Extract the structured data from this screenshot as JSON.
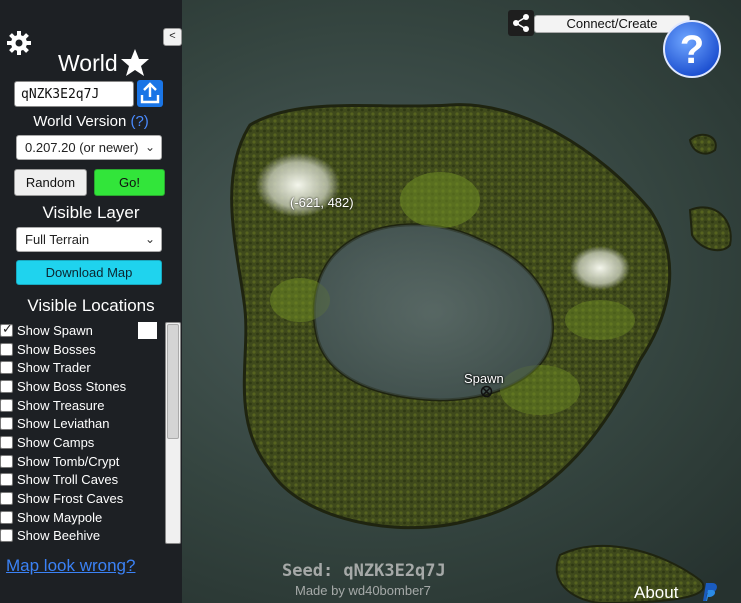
{
  "sidebar": {
    "world_title": "World",
    "seed_value": "qNZK3E2q7J",
    "world_version_label": "World Version",
    "world_version_help": "(?)",
    "world_version_selected": "0.207.20 (or newer)",
    "random_label": "Random",
    "go_label": "Go!",
    "visible_layer_label": "Visible Layer",
    "layer_selected": "Full Terrain",
    "download_label": "Download Map",
    "visible_locations_label": "Visible Locations",
    "locations": [
      {
        "label": "Show Spawn",
        "checked": true
      },
      {
        "label": "Show Bosses",
        "checked": false
      },
      {
        "label": "Show Trader",
        "checked": false
      },
      {
        "label": "Show Boss Stones",
        "checked": false
      },
      {
        "label": "Show Treasure",
        "checked": false
      },
      {
        "label": "Show Leviathan",
        "checked": false
      },
      {
        "label": "Show Camps",
        "checked": false
      },
      {
        "label": "Show Tomb/Crypt",
        "checked": false
      },
      {
        "label": "Show Troll Caves",
        "checked": false
      },
      {
        "label": "Show Frost Caves",
        "checked": false
      },
      {
        "label": "Show Maypole",
        "checked": false
      },
      {
        "label": "Show Beehive",
        "checked": false
      }
    ],
    "spawn_marker_color": "#ffffff",
    "map_wrong_link": "Map look wrong?",
    "collapse_label": "<"
  },
  "map": {
    "coords": "(-621, 482)",
    "spawn_label": "Spawn"
  },
  "overlay": {
    "connect_label": "Connect/Create",
    "help_icon": "question-mark-icon",
    "seed_footer": "Seed: qNZK3E2q7J",
    "made_by": "Made by wd40bomber7",
    "about_label": "About"
  },
  "colors": {
    "sidebar_bg": "#1d2024",
    "go_button": "#32e53a",
    "download_button": "#1fd3ee",
    "link": "#3b82f6",
    "seed_button": "#1a75e6"
  }
}
